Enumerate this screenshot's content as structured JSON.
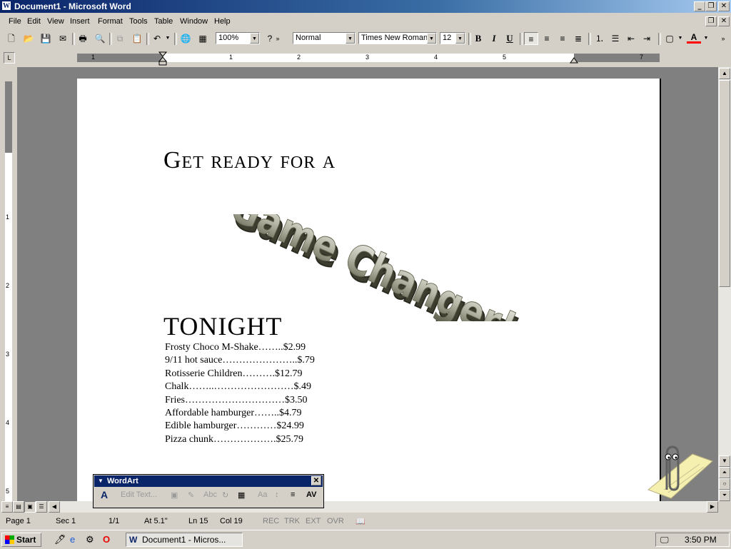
{
  "window": {
    "title": "Document1 - Microsoft Word",
    "app_icon": "W"
  },
  "menu": [
    "File",
    "Edit",
    "View",
    "Insert",
    "Format",
    "Tools",
    "Table",
    "Window",
    "Help"
  ],
  "toolbar": {
    "zoom": "100%",
    "style": "Normal",
    "font": "Times New Roman",
    "size": "12"
  },
  "ruler": {
    "numbers": [
      "1",
      "1",
      "2",
      "3",
      "4",
      "5",
      "7"
    ]
  },
  "vruler": {
    "numbers": [
      "1",
      "2",
      "3",
      "4",
      "5"
    ]
  },
  "document": {
    "heading_top": "Get ready for a",
    "wordart": "Game Changer!",
    "heading_bottom": "TONIGHT",
    "menu_items": [
      "Frosty Choco M-Shake……..$2.99",
      "9/11 hot sauce…………………..$.79",
      "Rotisserie Children……….$12.79",
      "Chalk……..……………………$.49",
      "Fries…………………………$3.50",
      "Affordable hamburger……..$4.79",
      "Edible hamburger…………$24.99",
      "Pizza chunk……………….$25.79"
    ]
  },
  "wordart_toolbar": {
    "title": "WordArt",
    "edit_text": "Edit Text..."
  },
  "status": {
    "page": "Page 1",
    "sec": "Sec 1",
    "pages": "1/1",
    "at": "At 5.1\"",
    "ln": "Ln 15",
    "col": "Col 19",
    "rec": "REC",
    "trk": "TRK",
    "ext": "EXT",
    "ovr": "OVR"
  },
  "taskbar": {
    "start": "Start",
    "task": "Document1 - Micros...",
    "clock": "3:50 PM"
  },
  "colors": {
    "title_bar": "#0a246a",
    "face": "#d4d0c8",
    "doc_background": "#808080",
    "font_color_underline": "#ff0000"
  }
}
